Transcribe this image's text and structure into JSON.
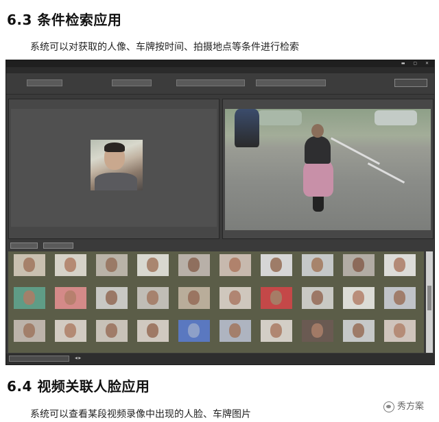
{
  "section_63": {
    "heading": "6.3 条件检索应用",
    "paragraph": "系统可以对获取的人像、车牌按时间、拍摄地点等条件进行检索"
  },
  "section_64": {
    "heading": "6.4 视频关联人脸应用",
    "paragraph": "系统可以查看某段视频录像中出现的人脸、车牌图片"
  },
  "watermark": {
    "text": "秀方案",
    "icon": "wechat-icon"
  },
  "colors": {
    "window_bg": "#3a3a3a",
    "thumbnail_grid_bg": "#5b5d48"
  },
  "thumbnails": [
    {
      "bg": "#c9c0b0",
      "face": "#a6816a"
    },
    {
      "bg": "#d6d2c8",
      "face": "#b58a73"
    },
    {
      "bg": "#b9b3a8",
      "face": "#9a7a66"
    },
    {
      "bg": "#d8d8d0",
      "face": "#a98670"
    },
    {
      "bg": "#b8b0a8",
      "face": "#8f6f5e"
    },
    {
      "bg": "#c7b9ae",
      "face": "#b0826c"
    },
    {
      "bg": "#d6d6d6",
      "face": "#9e7c68"
    },
    {
      "bg": "#c5c8c8",
      "face": "#a7846c"
    },
    {
      "bg": "#b2aca4",
      "face": "#8c6a5a"
    },
    {
      "bg": "#dcdcd8",
      "face": "#b38a76"
    },
    {
      "bg": "#5f9c86",
      "face": "#a3806a"
    },
    {
      "bg": "#d48a88",
      "face": "#b7806e"
    },
    {
      "bg": "#c8c8c4",
      "face": "#9a7866"
    },
    {
      "bg": "#c0bdb6",
      "face": "#a6826e"
    },
    {
      "bg": "#b9ad9a",
      "face": "#9a7561"
    },
    {
      "bg": "#cfc7bd",
      "face": "#b08572"
    },
    {
      "bg": "#c44848",
      "face": "#a67c66"
    },
    {
      "bg": "#c9c9c4",
      "face": "#9c7866"
    },
    {
      "bg": "#dcdcd6",
      "face": "#b98e7a"
    },
    {
      "bg": "#c0c3c8",
      "face": "#a07d6b"
    },
    {
      "bg": "#bcb3aa",
      "face": "#a27f6a"
    },
    {
      "bg": "#d2cbc2",
      "face": "#b38a74"
    },
    {
      "bg": "#c8c2b8",
      "face": "#a07c68"
    },
    {
      "bg": "#d0c9c0",
      "face": "#9f7a66"
    },
    {
      "bg": "#5a78c0",
      "face": "#8ea0c8"
    },
    {
      "bg": "#aeb4c0",
      "face": "#a37f6c"
    },
    {
      "bg": "#d3cec6",
      "face": "#b08772"
    },
    {
      "bg": "#6a5a52",
      "face": "#a17a66"
    },
    {
      "bg": "#c6c8c8",
      "face": "#9e7b68"
    },
    {
      "bg": "#cfc4bc",
      "face": "#b58c77"
    }
  ]
}
